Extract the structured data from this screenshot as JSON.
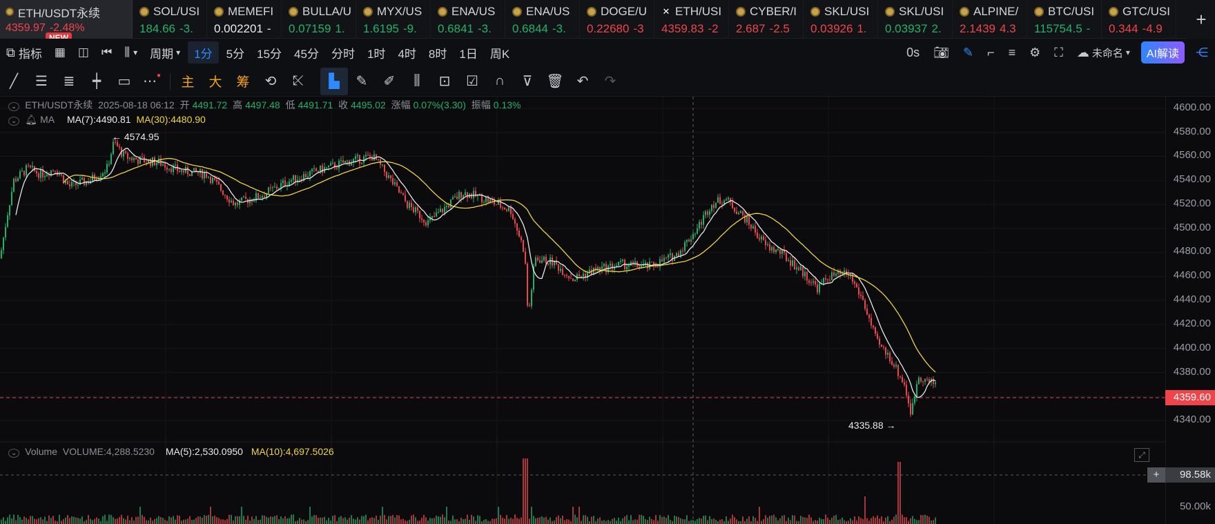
{
  "tabs": [
    {
      "symbol": "ETH/USDT永续",
      "price": "4359.97",
      "change": "-2.48%",
      "dir": "down",
      "icon": "coin-icon",
      "badge": "NEW"
    },
    {
      "symbol": "SOL/USI",
      "price": "184.66",
      "change": "-3.",
      "dir": "up",
      "icon": "coin-icon"
    },
    {
      "symbol": "MEMEFI",
      "price": "0.002201",
      "change": "-",
      "dir": "neutral",
      "icon": "coin-icon"
    },
    {
      "symbol": "BULLA/U",
      "price": "0.07159",
      "change": "1.",
      "dir": "up",
      "icon": "coin-icon"
    },
    {
      "symbol": "MYX/US",
      "price": "1.6195",
      "change": "-9.",
      "dir": "up",
      "icon": "coin-icon"
    },
    {
      "symbol": "ENA/US",
      "price": "0.6841",
      "change": "-3.",
      "dir": "up",
      "icon": "coin-icon"
    },
    {
      "symbol": "ENA/US",
      "price": "0.6844",
      "change": "-3.",
      "dir": "up",
      "icon": "coin-icon"
    },
    {
      "symbol": "DOGE/U",
      "price": "0.22680",
      "change": "-3",
      "dir": "down",
      "icon": "coin-icon"
    },
    {
      "symbol": "ETH/USI",
      "price": "4359.83",
      "change": "-2",
      "dir": "down",
      "icon": "x-icon"
    },
    {
      "symbol": "CYBER/I",
      "price": "2.687",
      "change": "-2.5",
      "dir": "down",
      "icon": "coin-icon"
    },
    {
      "symbol": "SKL/USI",
      "price": "0.03926",
      "change": "1.",
      "dir": "down",
      "icon": "coin-icon"
    },
    {
      "symbol": "SKL/USI",
      "price": "0.03937",
      "change": "2.",
      "dir": "up",
      "icon": "coin-icon"
    },
    {
      "symbol": "ALPINE/",
      "price": "2.1439",
      "change": "4.3",
      "dir": "down",
      "icon": "coin-icon"
    },
    {
      "symbol": "BTC/USI",
      "price": "115754.5",
      "change": "-",
      "dir": "up",
      "icon": "coin-icon"
    },
    {
      "symbol": "GTC/USI",
      "price": "0.344",
      "change": "-4.9",
      "dir": "down",
      "icon": "coin-icon"
    }
  ],
  "toolbar": {
    "indicators": "指标",
    "period": "周期",
    "intervals": [
      "1分",
      "5分",
      "15分",
      "45分",
      "分时",
      "1时",
      "4时",
      "8时",
      "1日",
      "周K"
    ],
    "selected_interval": "1分",
    "countdown": "0s",
    "layout_name": "未命名",
    "ai_label": "AI解读"
  },
  "drawtools": {
    "main": "主",
    "big": "大",
    "chips": "筹"
  },
  "ohlc": {
    "symbol": "ETH/USDT永续",
    "datetime": "2025-08-18 06:12",
    "open_label": "开",
    "open": "4491.72",
    "high_label": "高",
    "high": "4497.48",
    "low_label": "低",
    "low": "4491.71",
    "close_label": "收",
    "close": "4495.02",
    "change_label": "涨幅",
    "change": "0.07%(3.30)",
    "amp_label": "振幅",
    "amp": "0.13%"
  },
  "ma": {
    "label": "MA",
    "ma7": "MA(7):4490.81",
    "ma30": "MA(30):4480.90"
  },
  "volume": {
    "label": "Volume",
    "vol": "VOLUME:4,288.5230",
    "ma5": "MA(5):2,530.0950",
    "ma10": "MA(10):4,697.5026"
  },
  "price_axis": [
    "4600.00",
    "4580.00",
    "4560.00",
    "4540.00",
    "4520.00",
    "4500.00",
    "4480.00",
    "4460.00",
    "4440.00",
    "4420.00",
    "4400.00",
    "4380.00",
    "4340.00"
  ],
  "current_price": "4359.60",
  "vol_axis": [
    "50.00k"
  ],
  "vol_current": "98.58k",
  "high_marker": "← 4574.95",
  "low_marker": "4335.88 →",
  "colors": {
    "up": "#20b26c",
    "down": "#ef454a",
    "ma7": "#e8e9ec",
    "ma30": "#f0d53a",
    "accent": "#2e8bff"
  }
}
